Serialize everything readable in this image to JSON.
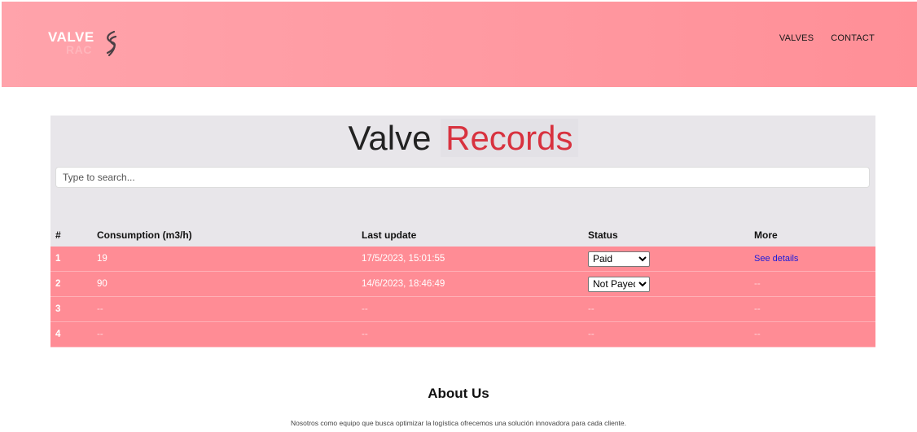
{
  "header": {
    "logo_main": "VALVE",
    "logo_sub": "RAC",
    "nav": [
      {
        "label": "VALVES"
      },
      {
        "label": "CONTACT"
      }
    ]
  },
  "records": {
    "title_part1": "Valve",
    "title_part2": "Records",
    "search_placeholder": "Type to search...",
    "columns": [
      "#",
      "Consumption (m3/h)",
      "Last update",
      "Status",
      "More"
    ],
    "rows": [
      {
        "index": "1",
        "consumption": "19",
        "last_update": "17/5/2023, 15:01:55",
        "status": "Paid",
        "more": "See details"
      },
      {
        "index": "2",
        "consumption": "90",
        "last_update": "14/6/2023, 18:46:49",
        "status": "Not Payed",
        "more": "--"
      },
      {
        "index": "3",
        "consumption": "--",
        "last_update": "--",
        "status": "--",
        "more": "--"
      },
      {
        "index": "4",
        "consumption": "--",
        "last_update": "--",
        "status": "--",
        "more": "--"
      }
    ],
    "status_options": [
      "Paid",
      "Not Payed"
    ]
  },
  "about": {
    "title": "About Us",
    "text": "Nosotros como equipo que busca optimizar la logística ofrecemos una solución innovadora para cada cliente."
  },
  "colors": {
    "header_gradient_start": "#ffa3ab",
    "header_gradient_end": "#ff8f97",
    "row_background": "#ff8c95",
    "accent_red": "#d8323f",
    "panel_background": "#e8e6ea",
    "link_blue": "#1a1adb"
  }
}
